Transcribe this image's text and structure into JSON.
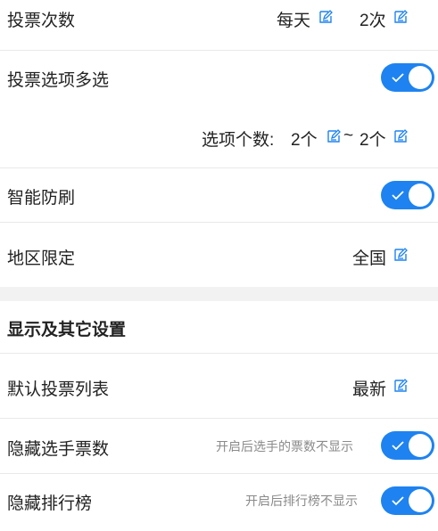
{
  "vote_count": {
    "label": "投票次数",
    "period": "每天",
    "times": "2次"
  },
  "multi_select": {
    "label": "投票选项多选",
    "enabled": true,
    "range_prefix": "选项个数:",
    "min": "2个",
    "separator": "~",
    "max": "2个"
  },
  "anti_fraud": {
    "label": "智能防刷",
    "enabled": true
  },
  "region": {
    "label": "地区限定",
    "value": "全国"
  },
  "display_section": {
    "title": "显示及其它设置"
  },
  "default_list": {
    "label": "默认投票列表",
    "value": "最新"
  },
  "hide_votes": {
    "label": "隐藏选手票数",
    "hint": "开启后选手的票数不显示",
    "enabled": true
  },
  "hide_ranking": {
    "label": "隐藏排行榜",
    "hint": "开启后排行榜不显示",
    "enabled": true
  },
  "colors": {
    "accent": "#1e83f0",
    "divider": "#e9e9e9",
    "hint": "#8a8a8a"
  },
  "icons": {
    "edit": "edit-icon",
    "check": "check-icon"
  }
}
